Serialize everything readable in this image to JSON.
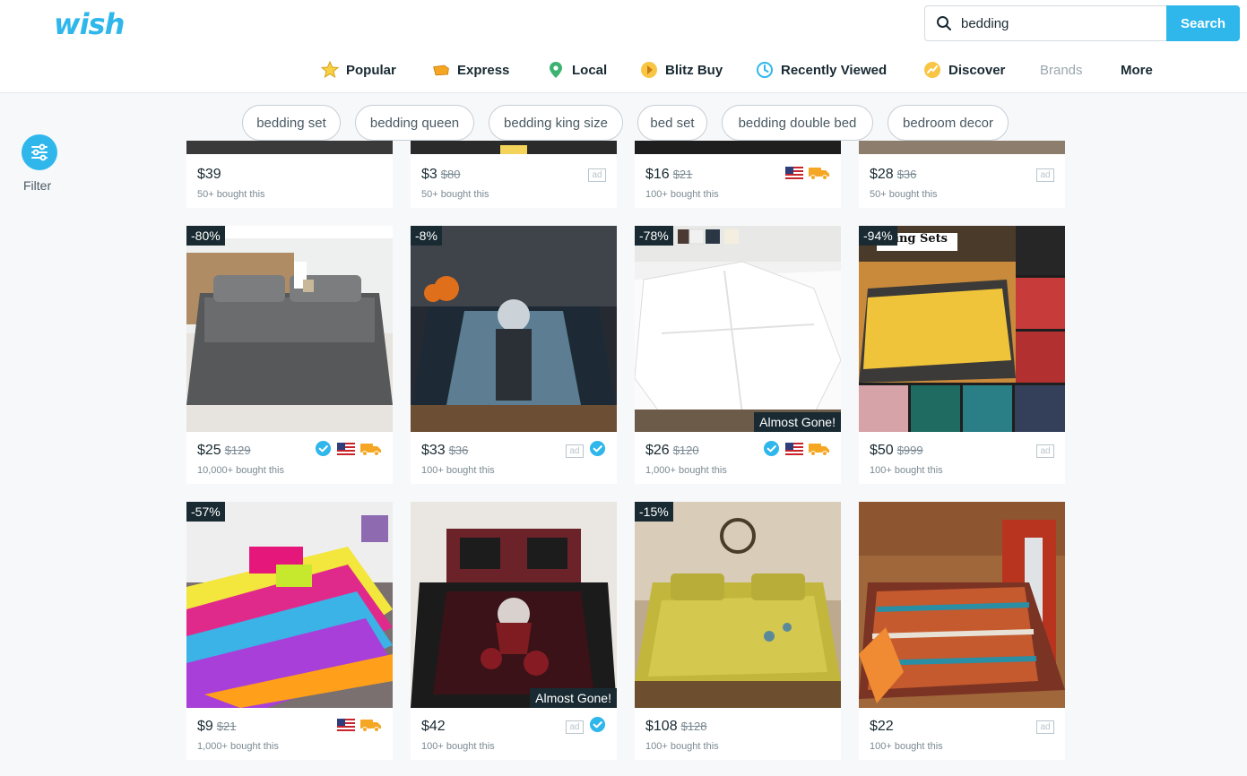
{
  "app": {
    "logo": "wish"
  },
  "search": {
    "value": "bedding",
    "button_label": "Search"
  },
  "nav": [
    {
      "label": "Popular",
      "icon": "star-icon"
    },
    {
      "label": "Express",
      "icon": "express-icon"
    },
    {
      "label": "Local",
      "icon": "location-pin-icon"
    },
    {
      "label": "Blitz Buy",
      "icon": "blitz-buy-icon"
    },
    {
      "label": "Recently Viewed",
      "icon": "clock-icon"
    },
    {
      "label": "Discover",
      "icon": "discover-icon"
    },
    {
      "label": "Brands"
    },
    {
      "label": "More"
    }
  ],
  "chips": [
    "bedding set",
    "bedding queen",
    "bedding king size",
    "bed set",
    "bedding double bed",
    "bedroom decor"
  ],
  "filter": {
    "label": "Filter",
    "icon": "sliders-icon"
  },
  "products": [
    {
      "price": "$39",
      "old_price": "",
      "bought": "50+ bought this",
      "ad": false,
      "verified": false,
      "us": false,
      "express": false,
      "discount": "",
      "almost_gone": ""
    },
    {
      "price": "$3",
      "old_price": "$80",
      "bought": "50+ bought this",
      "ad": true,
      "verified": false,
      "us": false,
      "express": false,
      "discount": "",
      "almost_gone": ""
    },
    {
      "price": "$16",
      "old_price": "$21",
      "bought": "100+ bought this",
      "ad": false,
      "verified": false,
      "us": true,
      "express": true,
      "discount": "",
      "almost_gone": ""
    },
    {
      "price": "$28",
      "old_price": "$36",
      "bought": "50+ bought this",
      "ad": true,
      "verified": false,
      "us": false,
      "express": false,
      "discount": "",
      "almost_gone": ""
    },
    {
      "price": "$25",
      "old_price": "$129",
      "bought": "10,000+ bought this",
      "ad": false,
      "verified": true,
      "us": true,
      "express": true,
      "discount": "-80%",
      "almost_gone": ""
    },
    {
      "price": "$33",
      "old_price": "$36",
      "bought": "100+ bought this",
      "ad": true,
      "verified": true,
      "us": false,
      "express": false,
      "discount": "-8%",
      "almost_gone": ""
    },
    {
      "price": "$26",
      "old_price": "$120",
      "bought": "1,000+ bought this",
      "ad": false,
      "verified": true,
      "us": true,
      "express": true,
      "discount": "-78%",
      "almost_gone": "Almost Gone!"
    },
    {
      "price": "$50",
      "old_price": "$999",
      "bought": "100+ bought this",
      "ad": true,
      "verified": false,
      "us": false,
      "express": false,
      "discount": "-94%",
      "almost_gone": "",
      "image_text": "ing Sets"
    },
    {
      "price": "$9",
      "old_price": "$21",
      "bought": "1,000+ bought this",
      "ad": false,
      "verified": false,
      "us": true,
      "express": true,
      "discount": "-57%",
      "almost_gone": ""
    },
    {
      "price": "$42",
      "old_price": "",
      "bought": "100+ bought this",
      "ad": true,
      "verified": true,
      "us": false,
      "express": false,
      "discount": "",
      "almost_gone": "Almost Gone!"
    },
    {
      "price": "$108",
      "old_price": "$128",
      "bought": "100+ bought this",
      "ad": false,
      "verified": false,
      "us": false,
      "express": false,
      "discount": "-15%",
      "almost_gone": ""
    },
    {
      "price": "$22",
      "old_price": "",
      "bought": "100+ bought this",
      "ad": true,
      "verified": false,
      "us": false,
      "express": false,
      "discount": "",
      "almost_gone": ""
    }
  ],
  "badge_text": {
    "ad": "ad"
  },
  "colors": {
    "brand": "#2fb7ec",
    "dark": "#192a32",
    "express": "#f5a623"
  }
}
